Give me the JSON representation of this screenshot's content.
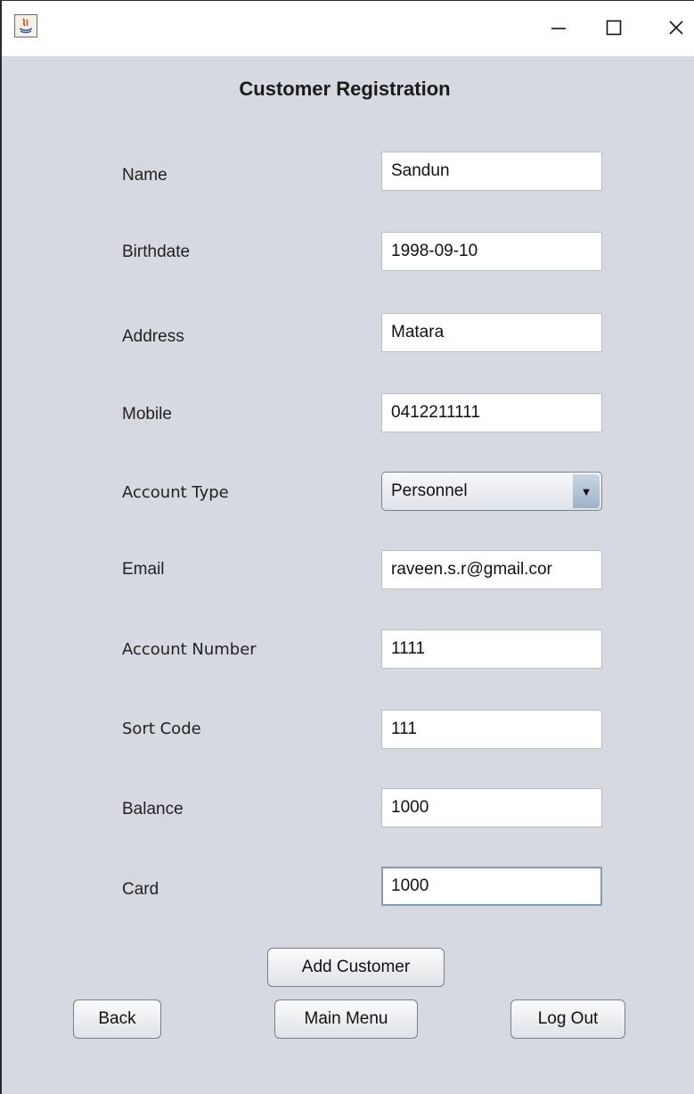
{
  "window": {
    "minimize_glyph": "—",
    "maximize_glyph": "☐",
    "close_glyph": "✕"
  },
  "form": {
    "title": "Customer Registration",
    "fields": [
      {
        "label": "Name",
        "value": "Sandun"
      },
      {
        "label": "Birthdate",
        "value": "1998-09-10"
      },
      {
        "label": "Address",
        "value": "Matara"
      },
      {
        "label": "Mobile",
        "value": "0412211111"
      },
      {
        "label": "Account Type",
        "value": "Personnel"
      },
      {
        "label": "Email",
        "value": "raveen.s.r@gmail.cor"
      },
      {
        "label": "Account Number",
        "value": "1111"
      },
      {
        "label": "Sort Code",
        "value": "111"
      },
      {
        "label": "Balance",
        "value": "1000"
      },
      {
        "label": "Card",
        "value": "1000"
      }
    ],
    "dropdown_arrow": "▼",
    "add_button": "Add Customer"
  },
  "footer": {
    "back": "Back",
    "main_menu": "Main Menu",
    "log_out": "Log Out"
  },
  "icons": {
    "app": "java-app-icon",
    "minimize": "minimize-icon",
    "maximize": "maximize-icon",
    "close": "close-icon",
    "dropdown": "chevron-down-icon"
  },
  "colors": {
    "panel_bg": "#d6d9df",
    "input_border": "#b9bec6",
    "focus_border": "#7f9db9"
  }
}
